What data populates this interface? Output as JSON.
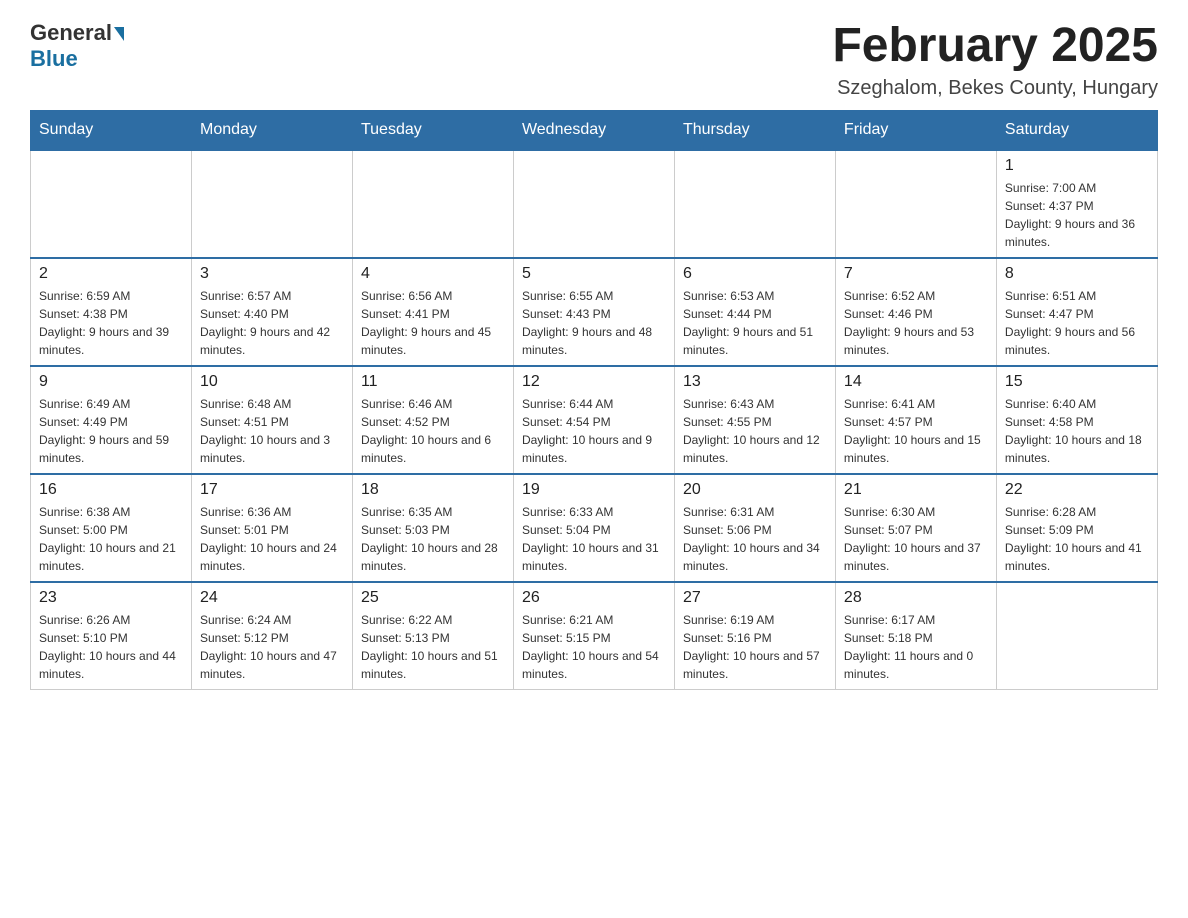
{
  "logo": {
    "general": "General",
    "blue": "Blue"
  },
  "header": {
    "month_title": "February 2025",
    "location": "Szeghalom, Bekes County, Hungary"
  },
  "weekdays": [
    "Sunday",
    "Monday",
    "Tuesday",
    "Wednesday",
    "Thursday",
    "Friday",
    "Saturday"
  ],
  "weeks": [
    [
      {
        "day": "",
        "info": ""
      },
      {
        "day": "",
        "info": ""
      },
      {
        "day": "",
        "info": ""
      },
      {
        "day": "",
        "info": ""
      },
      {
        "day": "",
        "info": ""
      },
      {
        "day": "",
        "info": ""
      },
      {
        "day": "1",
        "info": "Sunrise: 7:00 AM\nSunset: 4:37 PM\nDaylight: 9 hours and 36 minutes."
      }
    ],
    [
      {
        "day": "2",
        "info": "Sunrise: 6:59 AM\nSunset: 4:38 PM\nDaylight: 9 hours and 39 minutes."
      },
      {
        "day": "3",
        "info": "Sunrise: 6:57 AM\nSunset: 4:40 PM\nDaylight: 9 hours and 42 minutes."
      },
      {
        "day": "4",
        "info": "Sunrise: 6:56 AM\nSunset: 4:41 PM\nDaylight: 9 hours and 45 minutes."
      },
      {
        "day": "5",
        "info": "Sunrise: 6:55 AM\nSunset: 4:43 PM\nDaylight: 9 hours and 48 minutes."
      },
      {
        "day": "6",
        "info": "Sunrise: 6:53 AM\nSunset: 4:44 PM\nDaylight: 9 hours and 51 minutes."
      },
      {
        "day": "7",
        "info": "Sunrise: 6:52 AM\nSunset: 4:46 PM\nDaylight: 9 hours and 53 minutes."
      },
      {
        "day": "8",
        "info": "Sunrise: 6:51 AM\nSunset: 4:47 PM\nDaylight: 9 hours and 56 minutes."
      }
    ],
    [
      {
        "day": "9",
        "info": "Sunrise: 6:49 AM\nSunset: 4:49 PM\nDaylight: 9 hours and 59 minutes."
      },
      {
        "day": "10",
        "info": "Sunrise: 6:48 AM\nSunset: 4:51 PM\nDaylight: 10 hours and 3 minutes."
      },
      {
        "day": "11",
        "info": "Sunrise: 6:46 AM\nSunset: 4:52 PM\nDaylight: 10 hours and 6 minutes."
      },
      {
        "day": "12",
        "info": "Sunrise: 6:44 AM\nSunset: 4:54 PM\nDaylight: 10 hours and 9 minutes."
      },
      {
        "day": "13",
        "info": "Sunrise: 6:43 AM\nSunset: 4:55 PM\nDaylight: 10 hours and 12 minutes."
      },
      {
        "day": "14",
        "info": "Sunrise: 6:41 AM\nSunset: 4:57 PM\nDaylight: 10 hours and 15 minutes."
      },
      {
        "day": "15",
        "info": "Sunrise: 6:40 AM\nSunset: 4:58 PM\nDaylight: 10 hours and 18 minutes."
      }
    ],
    [
      {
        "day": "16",
        "info": "Sunrise: 6:38 AM\nSunset: 5:00 PM\nDaylight: 10 hours and 21 minutes."
      },
      {
        "day": "17",
        "info": "Sunrise: 6:36 AM\nSunset: 5:01 PM\nDaylight: 10 hours and 24 minutes."
      },
      {
        "day": "18",
        "info": "Sunrise: 6:35 AM\nSunset: 5:03 PM\nDaylight: 10 hours and 28 minutes."
      },
      {
        "day": "19",
        "info": "Sunrise: 6:33 AM\nSunset: 5:04 PM\nDaylight: 10 hours and 31 minutes."
      },
      {
        "day": "20",
        "info": "Sunrise: 6:31 AM\nSunset: 5:06 PM\nDaylight: 10 hours and 34 minutes."
      },
      {
        "day": "21",
        "info": "Sunrise: 6:30 AM\nSunset: 5:07 PM\nDaylight: 10 hours and 37 minutes."
      },
      {
        "day": "22",
        "info": "Sunrise: 6:28 AM\nSunset: 5:09 PM\nDaylight: 10 hours and 41 minutes."
      }
    ],
    [
      {
        "day": "23",
        "info": "Sunrise: 6:26 AM\nSunset: 5:10 PM\nDaylight: 10 hours and 44 minutes."
      },
      {
        "day": "24",
        "info": "Sunrise: 6:24 AM\nSunset: 5:12 PM\nDaylight: 10 hours and 47 minutes."
      },
      {
        "day": "25",
        "info": "Sunrise: 6:22 AM\nSunset: 5:13 PM\nDaylight: 10 hours and 51 minutes."
      },
      {
        "day": "26",
        "info": "Sunrise: 6:21 AM\nSunset: 5:15 PM\nDaylight: 10 hours and 54 minutes."
      },
      {
        "day": "27",
        "info": "Sunrise: 6:19 AM\nSunset: 5:16 PM\nDaylight: 10 hours and 57 minutes."
      },
      {
        "day": "28",
        "info": "Sunrise: 6:17 AM\nSunset: 5:18 PM\nDaylight: 11 hours and 0 minutes."
      },
      {
        "day": "",
        "info": ""
      }
    ]
  ]
}
